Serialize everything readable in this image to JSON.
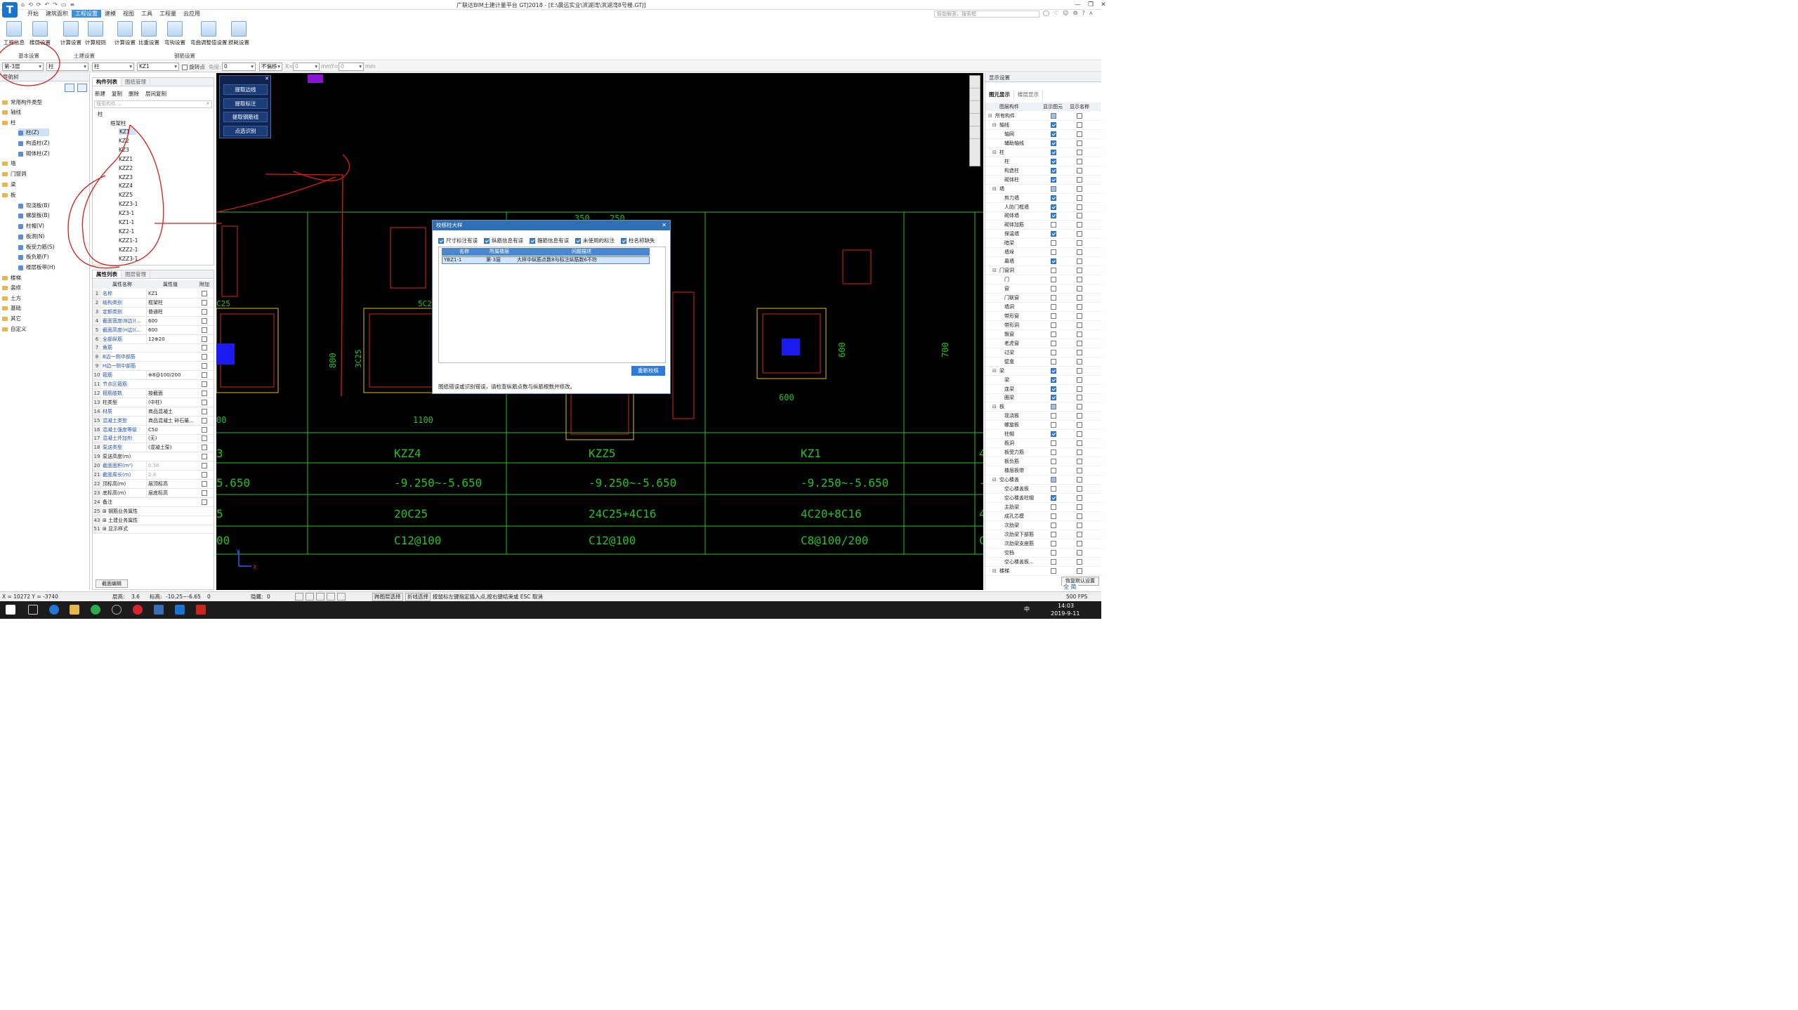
{
  "title": {
    "window_title": "广联达BIM土建计量平台 GTJ2018 - [E:\\晨远实业\\滨湖湾\\滨湖湾8号楼.GTJ]",
    "search_placeholder": "智能解答，搜索框",
    "quick_tools": [
      "⌂",
      "⟲",
      "⟳",
      "↶",
      "↷",
      "▭",
      "≡"
    ],
    "win_buttons": [
      "—",
      "❐",
      "✕"
    ],
    "right_icons": [
      "◯",
      "♡",
      "☺",
      "⚙",
      "?",
      "ʌ"
    ]
  },
  "menu": [
    "开始",
    "建筑面积",
    "工程设置",
    "建模",
    "视图",
    "工具",
    "工程量",
    "云应用"
  ],
  "menu_active_index": 2,
  "ribbon": {
    "buttons": [
      "工程信息",
      "楼层设置",
      "计算设置",
      "计算规则",
      "计算设置",
      "比重设置",
      "弯钩设置",
      "弯曲调整值设置",
      "损耗设置"
    ],
    "groups": [
      "基本设置",
      "土建设置",
      "钢筋设置"
    ]
  },
  "options": {
    "floor": "第-3层",
    "type": "柱",
    "subtype": "柱",
    "element": "KZ1",
    "rotate_label": "旋转点",
    "angle_label": "角度:",
    "angle_value": "0",
    "offset": "不偏移",
    "x_label": "X=",
    "x_value": "0",
    "mm1": "mm",
    "y_label": "Y=",
    "y_value": "0",
    "mm2": "mm"
  },
  "nav": {
    "header": "导航树",
    "items": [
      {
        "label": "常用构件类型",
        "level": 0
      },
      {
        "label": "轴线",
        "level": 0
      },
      {
        "label": "柱",
        "level": 0
      },
      {
        "label": "柱(Z)",
        "level": 1,
        "selected": true
      },
      {
        "label": "构造柱(Z)",
        "level": 1
      },
      {
        "label": "砌体柱(Z)",
        "level": 1
      },
      {
        "label": "墙",
        "level": 0
      },
      {
        "label": "门窗洞",
        "level": 0
      },
      {
        "label": "梁",
        "level": 0
      },
      {
        "label": "板",
        "level": 0
      },
      {
        "label": "现浇板(B)",
        "level": 1
      },
      {
        "label": "螺旋板(B)",
        "level": 1
      },
      {
        "label": "柱帽(V)",
        "level": 1
      },
      {
        "label": "板洞(N)",
        "level": 1
      },
      {
        "label": "板受力筋(S)",
        "level": 1
      },
      {
        "label": "板负筋(F)",
        "level": 1
      },
      {
        "label": "楼层板带(H)",
        "level": 1
      },
      {
        "label": "楼梯",
        "level": 0
      },
      {
        "label": "装修",
        "level": 0
      },
      {
        "label": "土方",
        "level": 0
      },
      {
        "label": "基础",
        "level": 0
      },
      {
        "label": "其它",
        "level": 0
      },
      {
        "label": "自定义",
        "level": 0
      }
    ]
  },
  "component_list": {
    "tabs": [
      "构件列表",
      "图纸管理"
    ],
    "toolbar": [
      "新建",
      "复制",
      "删除",
      "层间复制"
    ],
    "search_placeholder": "搜索构件...",
    "root": "柱",
    "group": "框架柱",
    "items": [
      "KZ1",
      "KZ2",
      "KZ3",
      "KZZ1",
      "KZZ2",
      "KZZ3",
      "KZZ4",
      "KZZ5",
      "KZZ3-1",
      "KZ3-1",
      "KZ1-1",
      "KZ2-1",
      "KZZ1-1",
      "KZZ2-1",
      "KZZ3-1"
    ]
  },
  "properties": {
    "tabs": [
      "属性列表",
      "图层管理"
    ],
    "headers": [
      "属性名称",
      "属性值",
      "附加"
    ],
    "rows": [
      {
        "n": "1",
        "k": "名称",
        "v": "KZ1",
        "blue": true
      },
      {
        "n": "2",
        "k": "结构类别",
        "v": "框架柱",
        "blue": true
      },
      {
        "n": "3",
        "k": "定额类别",
        "v": "普通柱",
        "blue": true
      },
      {
        "n": "4",
        "k": "截面宽度(B边)(...",
        "v": "600",
        "blue": true
      },
      {
        "n": "5",
        "k": "截面高度(H边)(...",
        "v": "600",
        "blue": true
      },
      {
        "n": "6",
        "k": "全部纵筋",
        "v": "12⊕20",
        "blue": true
      },
      {
        "n": "7",
        "k": "角筋",
        "v": "",
        "blue": true
      },
      {
        "n": "8",
        "k": "B边一侧中部筋",
        "v": "",
        "blue": true
      },
      {
        "n": "9",
        "k": "H边一侧中部筋",
        "v": "",
        "blue": true
      },
      {
        "n": "10",
        "k": "箍筋",
        "v": "⊕8@100/200",
        "blue": true
      },
      {
        "n": "11",
        "k": "节点区箍筋",
        "v": "",
        "blue": true
      },
      {
        "n": "12",
        "k": "箍筋肢数",
        "v": "按截面",
        "blue": true
      },
      {
        "n": "13",
        "k": "柱类型",
        "v": "(中柱)",
        "blue": false
      },
      {
        "n": "14",
        "k": "材质",
        "v": "商品混凝土",
        "blue": true
      },
      {
        "n": "15",
        "k": "混凝土类型",
        "v": "商品混凝土 碎石最...",
        "blue": true
      },
      {
        "n": "16",
        "k": "混凝土强度等级",
        "v": "C50",
        "blue": true
      },
      {
        "n": "17",
        "k": "混凝土外加剂",
        "v": "(无)",
        "blue": true
      },
      {
        "n": "18",
        "k": "泵送类型",
        "v": "(混凝土泵)",
        "blue": true
      },
      {
        "n": "19",
        "k": "泵送高度(m)",
        "v": "",
        "blue": false
      },
      {
        "n": "20",
        "k": "截面面积(m²)",
        "v": "0.36",
        "blue": true
      },
      {
        "n": "21",
        "k": "截面周长(m)",
        "v": "2.4",
        "blue": true
      },
      {
        "n": "22",
        "k": "顶标高(m)",
        "v": "层顶标高",
        "blue": false
      },
      {
        "n": "23",
        "k": "底标高(m)",
        "v": "层底标高",
        "blue": false
      },
      {
        "n": "24",
        "k": "备注",
        "v": "",
        "blue": false
      },
      {
        "n": "25",
        "k": "⊞ 钢筋业务属性",
        "v": "",
        "blue": false
      },
      {
        "n": "43",
        "k": "⊞ 土建业务属性",
        "v": "",
        "blue": false
      },
      {
        "n": "51",
        "k": "⊞ 显示样式",
        "v": "",
        "blue": false
      }
    ],
    "bottom_button": "截面编辑"
  },
  "float_panel": {
    "buttons": [
      "提取边线",
      "提取标注",
      "提取钢筋线",
      "点选识别"
    ]
  },
  "drawing": {
    "dims": [
      "350",
      "250",
      "C25",
      "5C25",
      "800",
      "3C25",
      "1100",
      "600",
      "600",
      "700",
      "00"
    ],
    "cols": [
      {
        "name": "3",
        "elev": "5.650",
        "rebar": "5",
        "stirrup": "00"
      },
      {
        "name": "KZZ4",
        "elev": "-9.250~-5.650",
        "rebar": "20C25",
        "stirrup": "C12@100"
      },
      {
        "name": "KZZ5",
        "elev": "-9.250~-5.650",
        "rebar": "24C25+4C16",
        "stirrup": "C12@100"
      },
      {
        "name": "KZ1",
        "elev": "-9.250~-5.650",
        "rebar": "4C20+8C16",
        "stirrup": "C8@100/200"
      },
      {
        "name": "4",
        "elev": "-9",
        "rebar": "4",
        "stirrup": "C"
      }
    ],
    "axis_x": "X",
    "axis_y": "Y"
  },
  "dialog": {
    "title": "校核柱大样",
    "filters": [
      "尺寸标注有误",
      "纵筋信息有误",
      "箍筋信息有误",
      "未使用的标注",
      "柱名称缺失"
    ],
    "headers": [
      "名称",
      "所属楼层",
      "问题描述"
    ],
    "row": {
      "name": "YBZ1-1",
      "floor": "第-3层",
      "desc": "大样中纵筋点数8与标注纵筋数6不符"
    },
    "recheck": "重新校核",
    "footer": "图纸错误或识别错误，请检查纵筋点数与纵筋根数并修改。"
  },
  "layers": {
    "title": "显示设置",
    "tabs": [
      "图元显示",
      "楼层显示"
    ],
    "headers": [
      "图层构件",
      "显示图元",
      "显示名称"
    ],
    "rows": [
      {
        "label": "所有构件",
        "lv": 0,
        "exp": "⊟",
        "a": "part",
        "b": false
      },
      {
        "label": "轴线",
        "lv": 1,
        "exp": "⊟",
        "a": true,
        "b": false
      },
      {
        "label": "轴网",
        "lv": 2,
        "exp": "",
        "a": true,
        "b": false
      },
      {
        "label": "辅助轴线",
        "lv": 2,
        "exp": "",
        "a": true,
        "b": false
      },
      {
        "label": "柱",
        "lv": 1,
        "exp": "⊟",
        "a": true,
        "b": false
      },
      {
        "label": "柱",
        "lv": 2,
        "exp": "",
        "a": true,
        "b": false
      },
      {
        "label": "构造柱",
        "lv": 2,
        "exp": "",
        "a": true,
        "b": false
      },
      {
        "label": "砌体柱",
        "lv": 2,
        "exp": "",
        "a": true,
        "b": false
      },
      {
        "label": "墙",
        "lv": 1,
        "exp": "⊟",
        "a": "part",
        "b": false
      },
      {
        "label": "剪力墙",
        "lv": 2,
        "exp": "",
        "a": true,
        "b": false
      },
      {
        "label": "人防门框墙",
        "lv": 2,
        "exp": "",
        "a": true,
        "b": false
      },
      {
        "label": "砌体墙",
        "lv": 2,
        "exp": "",
        "a": true,
        "b": false
      },
      {
        "label": "砌体加筋",
        "lv": 2,
        "exp": "",
        "a": false,
        "b": false
      },
      {
        "label": "保温墙",
        "lv": 2,
        "exp": "",
        "a": true,
        "b": false
      },
      {
        "label": "暗梁",
        "lv": 2,
        "exp": "",
        "a": false,
        "b": false
      },
      {
        "label": "墙垛",
        "lv": 2,
        "exp": "",
        "a": false,
        "b": false
      },
      {
        "label": "幕墙",
        "lv": 2,
        "exp": "",
        "a": true,
        "b": false
      },
      {
        "label": "门窗洞",
        "lv": 1,
        "exp": "⊟",
        "a": false,
        "b": false
      },
      {
        "label": "门",
        "lv": 2,
        "exp": "",
        "a": false,
        "b": false
      },
      {
        "label": "窗",
        "lv": 2,
        "exp": "",
        "a": false,
        "b": false
      },
      {
        "label": "门联窗",
        "lv": 2,
        "exp": "",
        "a": false,
        "b": false
      },
      {
        "label": "墙洞",
        "lv": 2,
        "exp": "",
        "a": false,
        "b": false
      },
      {
        "label": "带形窗",
        "lv": 2,
        "exp": "",
        "a": false,
        "b": false
      },
      {
        "label": "带形洞",
        "lv": 2,
        "exp": "",
        "a": false,
        "b": false
      },
      {
        "label": "飘窗",
        "lv": 2,
        "exp": "",
        "a": false,
        "b": false
      },
      {
        "label": "老虎窗",
        "lv": 2,
        "exp": "",
        "a": false,
        "b": false
      },
      {
        "label": "过梁",
        "lv": 2,
        "exp": "",
        "a": false,
        "b": false
      },
      {
        "label": "壁龛",
        "lv": 2,
        "exp": "",
        "a": false,
        "b": false
      },
      {
        "label": "梁",
        "lv": 1,
        "exp": "⊟",
        "a": true,
        "b": false
      },
      {
        "label": "梁",
        "lv": 2,
        "exp": "",
        "a": true,
        "b": false
      },
      {
        "label": "连梁",
        "lv": 2,
        "exp": "",
        "a": true,
        "b": false
      },
      {
        "label": "圈梁",
        "lv": 2,
        "exp": "",
        "a": true,
        "b": false
      },
      {
        "label": "板",
        "lv": 1,
        "exp": "⊟",
        "a": "part",
        "b": false
      },
      {
        "label": "现浇板",
        "lv": 2,
        "exp": "",
        "a": false,
        "b": false
      },
      {
        "label": "螺旋板",
        "lv": 2,
        "exp": "",
        "a": false,
        "b": false
      },
      {
        "label": "柱帽",
        "lv": 2,
        "exp": "",
        "a": true,
        "b": false
      },
      {
        "label": "板洞",
        "lv": 2,
        "exp": "",
        "a": false,
        "b": false
      },
      {
        "label": "板受力筋",
        "lv": 2,
        "exp": "",
        "a": false,
        "b": false
      },
      {
        "label": "板负筋",
        "lv": 2,
        "exp": "",
        "a": false,
        "b": false
      },
      {
        "label": "楼层板带",
        "lv": 2,
        "exp": "",
        "a": false,
        "b": false
      },
      {
        "label": "空心楼盖",
        "lv": 1,
        "exp": "⊟",
        "a": "part",
        "b": false
      },
      {
        "label": "空心楼盖板",
        "lv": 2,
        "exp": "",
        "a": false,
        "b": false
      },
      {
        "label": "空心楼盖柱帽",
        "lv": 2,
        "exp": "",
        "a": true,
        "b": false
      },
      {
        "label": "主肋梁",
        "lv": 2,
        "exp": "",
        "a": false,
        "b": false
      },
      {
        "label": "成孔芯模",
        "lv": 2,
        "exp": "",
        "a": false,
        "b": false
      },
      {
        "label": "次肋梁",
        "lv": 2,
        "exp": "",
        "a": false,
        "b": false
      },
      {
        "label": "次肋梁下部筋",
        "lv": 2,
        "exp": "",
        "a": false,
        "b": false
      },
      {
        "label": "次肋梁支座筋",
        "lv": 2,
        "exp": "",
        "a": false,
        "b": false
      },
      {
        "label": "空档",
        "lv": 2,
        "exp": "",
        "a": false,
        "b": false
      },
      {
        "label": "空心楼盖板...",
        "lv": 2,
        "exp": "",
        "a": false,
        "b": false
      },
      {
        "label": "楼梯",
        "lv": 1,
        "exp": "⊟",
        "a": false,
        "b": false
      }
    ],
    "restore_button": "恢复默认设置"
  },
  "status": {
    "coords": "X = 10272 Y = -3740",
    "floor_h_label": "层高:",
    "floor_h": "3.6",
    "elev_label": "标高:",
    "elev": "-10.25~-6.65",
    "zero": "0",
    "hidden_label": "隐藏:",
    "hidden": "0",
    "span_btn": "跨图层选择",
    "poly_btn": "折线选择",
    "hint": "按鼠标左键指定插入点,按右键结束或 ESC 取消",
    "fps": "500 FPS",
    "ime": "全 简"
  },
  "taskbar": {
    "time": "14:03",
    "date": "2019-9-11",
    "tray_lang": "中"
  }
}
